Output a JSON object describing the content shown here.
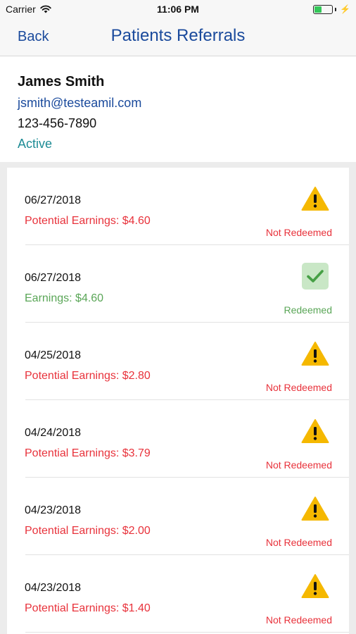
{
  "status_bar": {
    "carrier": "Carrier",
    "time": "11:06 PM"
  },
  "nav": {
    "back_label": "Back",
    "title": "Patients Referrals"
  },
  "patient": {
    "name": "James Smith",
    "email": "jsmith@testeamil.com",
    "phone": "123-456-7890",
    "status": "Active"
  },
  "referrals": [
    {
      "date": "06/27/2018",
      "earnings": "Potential Earnings: $4.60",
      "status": "Not Redeemed",
      "redeemed": false,
      "icon": "warning-icon"
    },
    {
      "date": "06/27/2018",
      "earnings": "Earnings: $4.60",
      "status": "Redeemed",
      "redeemed": true,
      "icon": "checkmark-icon"
    },
    {
      "date": "04/25/2018",
      "earnings": "Potential Earnings: $2.80",
      "status": "Not Redeemed",
      "redeemed": false,
      "icon": "warning-icon"
    },
    {
      "date": "04/24/2018",
      "earnings": "Potential Earnings: $3.79",
      "status": "Not Redeemed",
      "redeemed": false,
      "icon": "warning-icon"
    },
    {
      "date": "04/23/2018",
      "earnings": "Potential Earnings: $2.00",
      "status": "Not Redeemed",
      "redeemed": false,
      "icon": "warning-icon"
    },
    {
      "date": "04/23/2018",
      "earnings": "Potential Earnings: $1.40",
      "status": "Not Redeemed",
      "redeemed": false,
      "icon": "warning-icon"
    }
  ],
  "colors": {
    "accent": "#1a4a9c",
    "active": "#1e8c95",
    "not_redeemed": "#e8323b",
    "redeemed": "#5aa657",
    "warning": "#f5b800"
  }
}
